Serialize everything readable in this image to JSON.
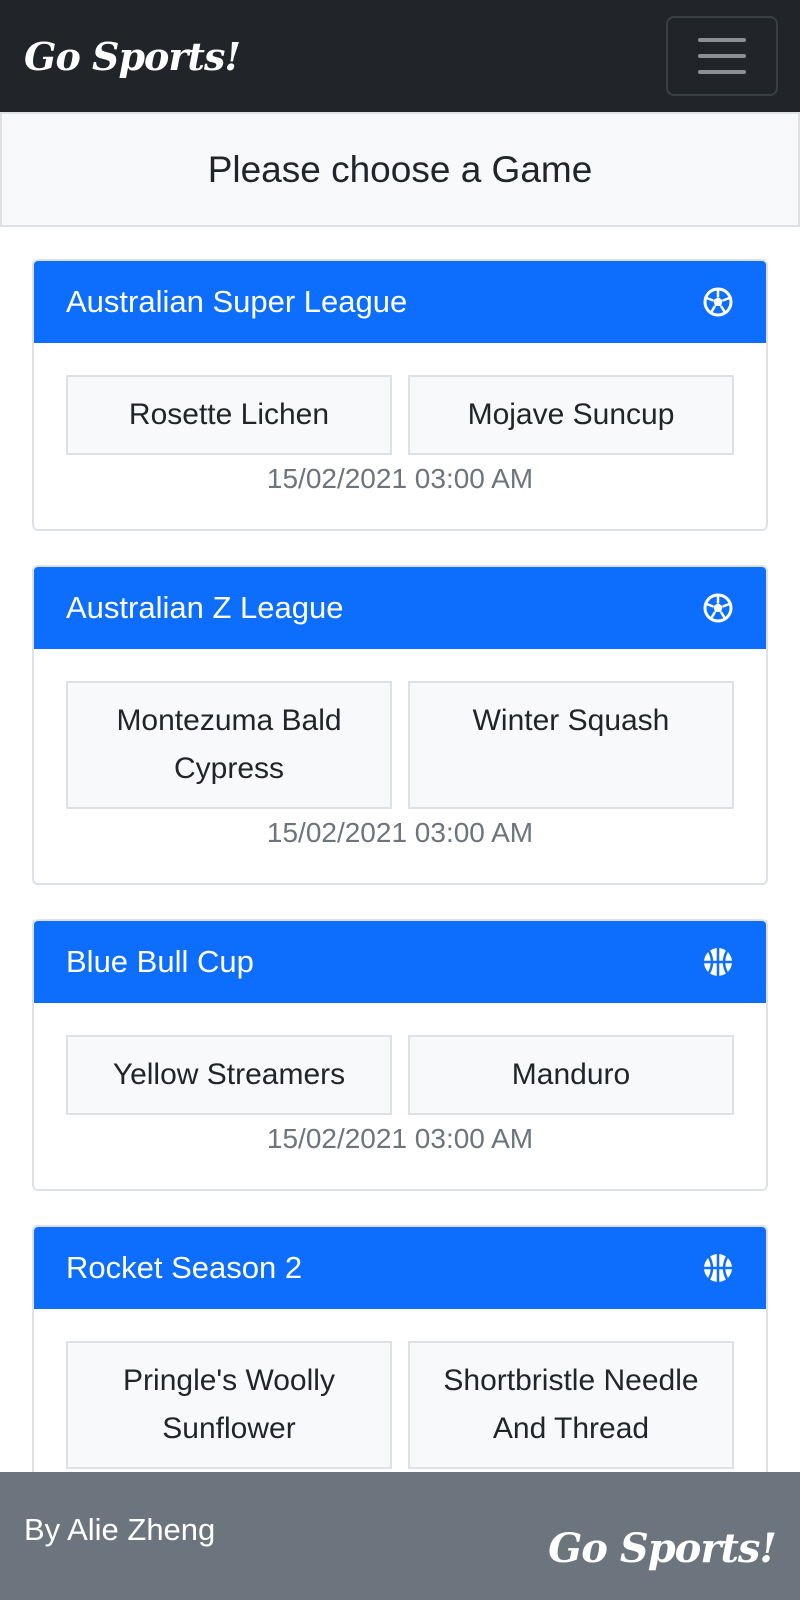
{
  "nav": {
    "brand": "Go Sports!",
    "menu_icon": "hamburger-icon"
  },
  "page": {
    "title": "Please choose a Game"
  },
  "games": [
    {
      "league": "Australian Super League",
      "sport_icon": "soccer-ball-icon",
      "team_a": "Rosette Lichen",
      "team_b": "Mojave Suncup",
      "date": "15/02/2021 03:00 AM"
    },
    {
      "league": "Australian Z League",
      "sport_icon": "soccer-ball-icon",
      "team_a": "Montezuma Bald Cypress",
      "team_b": "Winter Squash",
      "date": "15/02/2021 03:00 AM"
    },
    {
      "league": "Blue Bull Cup",
      "sport_icon": "basketball-icon",
      "team_a": "Yellow Streamers",
      "team_b": "Manduro",
      "date": "15/02/2021 03:00 AM"
    },
    {
      "league": "Rocket Season 2",
      "sport_icon": "basketball-icon",
      "team_a": "Pringle's Woolly Sunflower",
      "team_b": "Shortbristle Needle And Thread",
      "date": ""
    }
  ],
  "footer": {
    "byline": "By Alie Zheng",
    "brand": "Go Sports!"
  }
}
